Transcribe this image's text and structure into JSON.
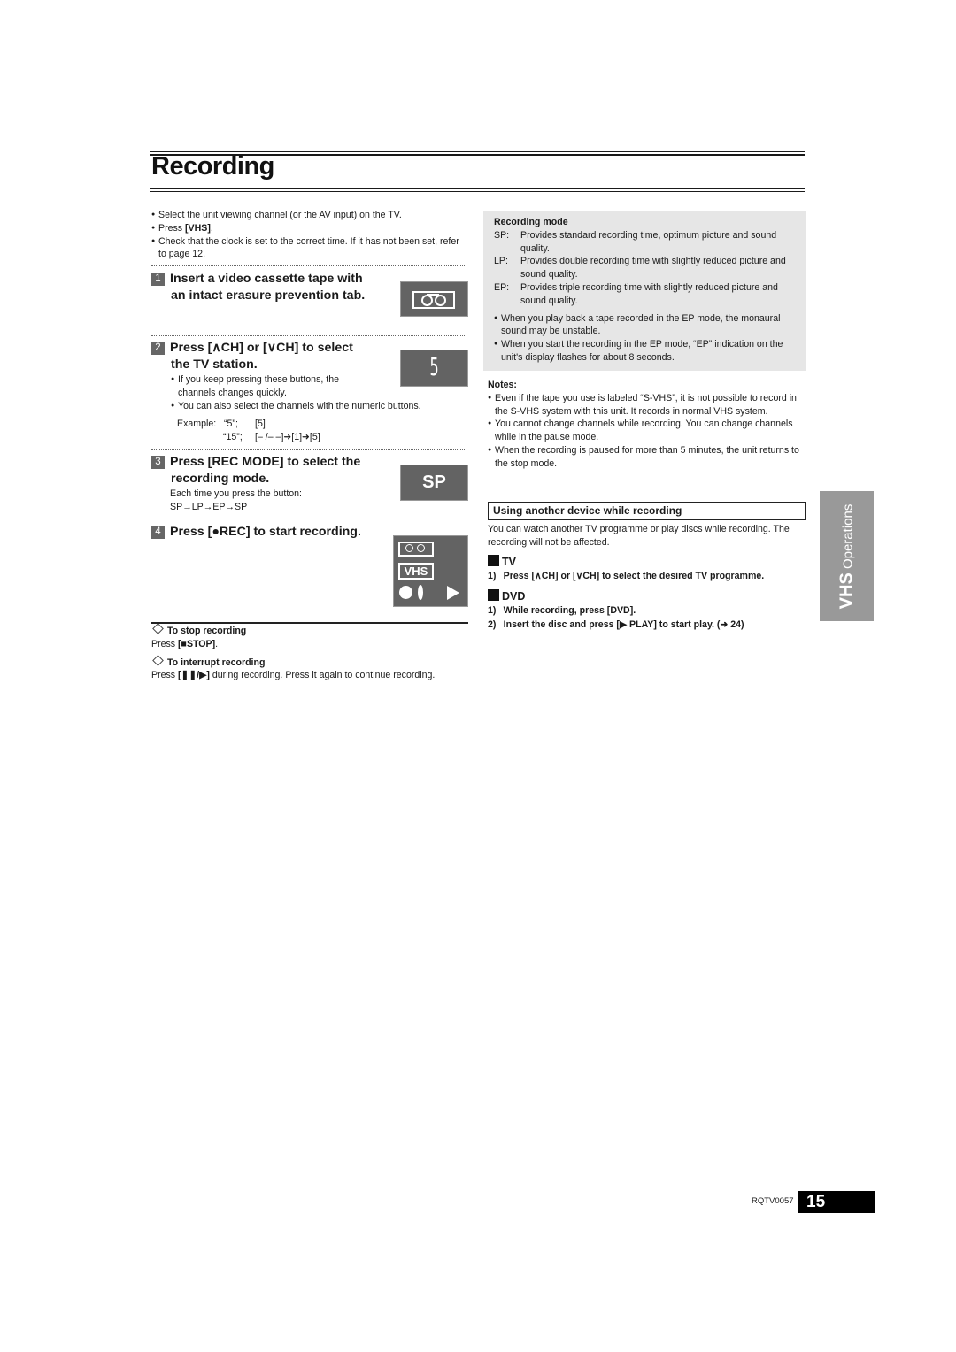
{
  "page": {
    "title": "Recording",
    "doc_code": "RQTV0057",
    "page_number": "15",
    "side_tab": {
      "strong": "VHS",
      "rest": " Operations"
    }
  },
  "intro": [
    "Select the unit viewing channel (or the AV input) on the TV.",
    {
      "pre": "Press ",
      "bold": "[VHS]",
      "post": "."
    },
    "Check that the clock is set to the correct time. If it has not been set, refer to page 12."
  ],
  "steps": [
    {
      "num": "1",
      "heading_line1": "Insert a video cassette tape with",
      "heading_line2": "an intact erasure prevention tab.",
      "display_icon": "cassette-icon"
    },
    {
      "num": "2",
      "heading_line1": "Press [∧CH] or [∨CH] to select",
      "heading_line2": "the TV station.",
      "display_icon": "channel-digit-display",
      "display_value": "5",
      "bullets": [
        "If you keep pressing these buttons, the channels changes quickly.",
        "You can also select the channels with the numeric buttons."
      ],
      "example_label": "Example:",
      "examples": [
        {
          "key": "“5”;",
          "value": "[5]"
        },
        {
          "key": "“15”;",
          "value": "[– /– –]➜[1]➜[5]"
        }
      ]
    },
    {
      "num": "3",
      "heading_line1": "Press [REC MODE] to select the",
      "heading_line2": "recording mode.",
      "display_value": "SP",
      "note_line1": "Each time you press the button:",
      "note_line2": "SP→LP→EP→SP"
    },
    {
      "num": "4",
      "heading_line1": "Press [●REC] to start recording.",
      "display_badge": "VHS"
    }
  ],
  "tips": [
    {
      "title": "To stop recording",
      "pre": "Press ",
      "bold": "[■STOP]",
      "post": "."
    },
    {
      "title": "To interrupt recording",
      "pre": "Press ",
      "bold": "[❚❚/▶]",
      "post": " during recording. Press it again to continue recording."
    }
  ],
  "recording_mode": {
    "title": "Recording mode",
    "modes": [
      {
        "key": "SP:",
        "text": "Provides standard recording time, optimum picture and sound quality."
      },
      {
        "key": "LP:",
        "text": "Provides double recording time with slightly reduced picture and sound quality."
      },
      {
        "key": "EP:",
        "text": "Provides triple recording time with slightly reduced picture and sound quality."
      }
    ],
    "bullets": [
      "When you play back a tape recorded in the EP mode, the monaural sound may be unstable.",
      "When you start the recording in the EP mode, “EP” indication on the unit's display flashes for about 8 seconds."
    ]
  },
  "notes": {
    "title": "Notes:",
    "items": [
      "Even if the tape you use is labeled “S-VHS”, it is not possible to record in the S-VHS system with this unit. It records in normal VHS system.",
      "You cannot change channels while recording. You can change channels while in the pause mode.",
      "When the recording is paused for more than 5 minutes, the unit returns to the stop mode."
    ]
  },
  "another_device": {
    "title": "Using another device while recording",
    "description": "You can watch another TV programme or play discs while recording. The recording will not be affected.",
    "sections": [
      {
        "name": "TV",
        "items": [
          "1)  Press [∧CH] or [∨CH] to select the desired TV programme."
        ]
      },
      {
        "name": "DVD",
        "items": [
          "1)  While recording, press [DVD].",
          "2)  Insert the disc and press [▶ PLAY] to start play. (➜ 24)"
        ]
      }
    ]
  }
}
